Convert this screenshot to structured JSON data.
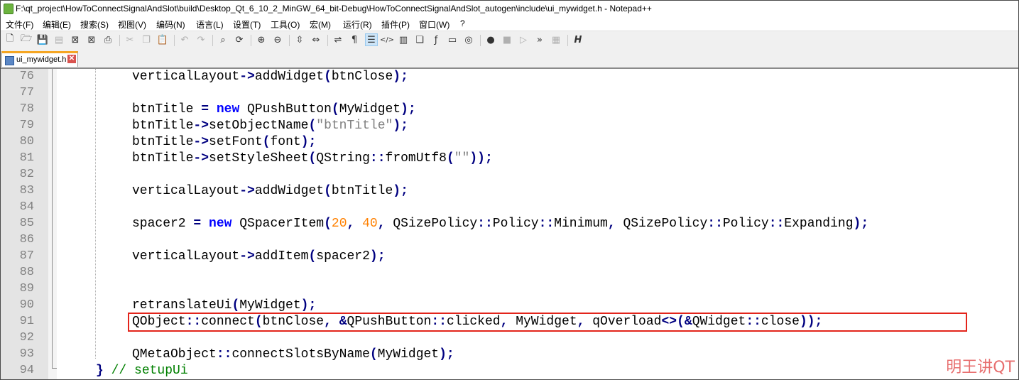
{
  "window": {
    "title": "F:\\qt_project\\HowToConnectSignalAndSlot\\build\\Desktop_Qt_6_10_2_MinGW_64_bit-Debug\\HowToConnectSignalAndSlot_autogen\\include\\ui_mywidget.h - Notepad++"
  },
  "menu": [
    "文件(F)",
    "编辑(E)",
    "搜索(S)",
    "视图(V)",
    "编码(N)",
    "语言(L)",
    "设置(T)",
    "工具(O)",
    "宏(M)",
    "运行(R)",
    "插件(P)",
    "窗口(W)",
    "?"
  ],
  "toolbar": {
    "icons": [
      "new-file-icon",
      "open-file-icon",
      "save-icon",
      "save-all-icon",
      "close-icon",
      "close-all-icon",
      "print-icon",
      "cut-icon",
      "copy-icon",
      "paste-icon",
      "undo-icon",
      "redo-icon",
      "find-icon",
      "replace-icon",
      "zoom-in-icon",
      "zoom-out-icon",
      "sync-vertical-icon",
      "sync-horizontal-icon",
      "word-wrap-icon",
      "show-all-chars-icon",
      "indent-guide-icon",
      "xml-icon",
      "document-map-icon",
      "function-list-icon",
      "fx-icon",
      "monitor-icon",
      "folder-workspace-icon",
      "record-macro-icon",
      "stop-macro-icon",
      "play-macro-icon",
      "run-macro-multiple-icon",
      "save-macro-icon",
      "spell-check-icon"
    ]
  },
  "tab": {
    "label": "ui_mywidget.h",
    "close": "✕"
  },
  "editor": {
    "lines": [
      {
        "n": "76",
        "t": [
          [
            "",
            "vertical"
          ],
          [
            "",
            "Layout"
          ],
          [
            "op",
            "->"
          ],
          [
            "",
            "addWidget"
          ],
          [
            "op",
            "("
          ],
          [
            "",
            "btnClose"
          ],
          [
            "op",
            ");"
          ]
        ]
      },
      {
        "n": "77",
        "t": []
      },
      {
        "n": "78",
        "t": [
          [
            "",
            "btnTitle "
          ],
          [
            "op",
            "="
          ],
          [
            "",
            " "
          ],
          [
            "kw",
            "new"
          ],
          [
            "",
            " QPushButton"
          ],
          [
            "op",
            "("
          ],
          [
            "",
            "MyWidget"
          ],
          [
            "op",
            ");"
          ]
        ]
      },
      {
        "n": "79",
        "t": [
          [
            "",
            "btnTitle"
          ],
          [
            "op",
            "->"
          ],
          [
            "",
            "setObjectName"
          ],
          [
            "op",
            "("
          ],
          [
            "str",
            "\"btnTitle\""
          ],
          [
            "op",
            ");"
          ]
        ]
      },
      {
        "n": "80",
        "t": [
          [
            "",
            "btnTitle"
          ],
          [
            "op",
            "->"
          ],
          [
            "",
            "setFont"
          ],
          [
            "op",
            "("
          ],
          [
            "",
            "font"
          ],
          [
            "op",
            ");"
          ]
        ]
      },
      {
        "n": "81",
        "t": [
          [
            "",
            "btnTitle"
          ],
          [
            "op",
            "->"
          ],
          [
            "",
            "setStyleSheet"
          ],
          [
            "op",
            "("
          ],
          [
            "",
            "QString"
          ],
          [
            "op",
            "::"
          ],
          [
            "",
            "fromUtf8"
          ],
          [
            "op",
            "("
          ],
          [
            "str",
            "\"\""
          ],
          [
            "op",
            "));"
          ]
        ]
      },
      {
        "n": "82",
        "t": []
      },
      {
        "n": "83",
        "t": [
          [
            "",
            "verticalLayout"
          ],
          [
            "op",
            "->"
          ],
          [
            "",
            "addWidget"
          ],
          [
            "op",
            "("
          ],
          [
            "",
            "btnTitle"
          ],
          [
            "op",
            ");"
          ]
        ]
      },
      {
        "n": "84",
        "t": []
      },
      {
        "n": "85",
        "t": [
          [
            "",
            "spacer2 "
          ],
          [
            "op",
            "="
          ],
          [
            "",
            " "
          ],
          [
            "kw",
            "new"
          ],
          [
            "",
            " QSpacerItem"
          ],
          [
            "op",
            "("
          ],
          [
            "num",
            "20"
          ],
          [
            "op",
            ","
          ],
          [
            "",
            " "
          ],
          [
            "num",
            "40"
          ],
          [
            "op",
            ","
          ],
          [
            "",
            " QSizePolicy"
          ],
          [
            "op",
            "::"
          ],
          [
            "",
            "Policy"
          ],
          [
            "op",
            "::"
          ],
          [
            "",
            "Minimum"
          ],
          [
            "op",
            ","
          ],
          [
            "",
            " QSizePolicy"
          ],
          [
            "op",
            "::"
          ],
          [
            "",
            "Policy"
          ],
          [
            "op",
            "::"
          ],
          [
            "",
            "Expanding"
          ],
          [
            "op",
            ");"
          ]
        ]
      },
      {
        "n": "86",
        "t": []
      },
      {
        "n": "87",
        "t": [
          [
            "",
            "verticalLayout"
          ],
          [
            "op",
            "->"
          ],
          [
            "",
            "addItem"
          ],
          [
            "op",
            "("
          ],
          [
            "",
            "spacer2"
          ],
          [
            "op",
            ");"
          ]
        ]
      },
      {
        "n": "88",
        "t": []
      },
      {
        "n": "89",
        "t": []
      },
      {
        "n": "90",
        "t": [
          [
            "",
            "retranslateUi"
          ],
          [
            "op",
            "("
          ],
          [
            "",
            "MyWidget"
          ],
          [
            "op",
            ");"
          ]
        ]
      },
      {
        "n": "91",
        "t": [
          [
            "",
            "QObject"
          ],
          [
            "op",
            "::"
          ],
          [
            "",
            "connect"
          ],
          [
            "op",
            "("
          ],
          [
            "",
            "btnClose"
          ],
          [
            "op",
            ","
          ],
          [
            "",
            " "
          ],
          [
            "op",
            "&"
          ],
          [
            "",
            "QPushButton"
          ],
          [
            "op",
            "::"
          ],
          [
            "",
            "clicked"
          ],
          [
            "op",
            ","
          ],
          [
            "",
            " MyWidget"
          ],
          [
            "op",
            ","
          ],
          [
            "",
            " qOverload"
          ],
          [
            "op",
            "<>("
          ],
          [
            "op",
            "&"
          ],
          [
            "",
            "QWidget"
          ],
          [
            "op",
            "::"
          ],
          [
            "",
            "close"
          ],
          [
            "op",
            "));"
          ]
        ]
      },
      {
        "n": "92",
        "t": []
      },
      {
        "n": "93",
        "t": [
          [
            "",
            "QMetaObject"
          ],
          [
            "op",
            "::"
          ],
          [
            "",
            "connectSlotsByName"
          ],
          [
            "op",
            "("
          ],
          [
            "",
            "MyWidget"
          ],
          [
            "op",
            ");"
          ]
        ]
      },
      {
        "n": "94",
        "t": [
          [
            "op",
            "}"
          ],
          [
            "",
            " "
          ],
          [
            "cmt",
            "// setupUi"
          ]
        ]
      }
    ]
  },
  "watermark": "明王讲QT"
}
